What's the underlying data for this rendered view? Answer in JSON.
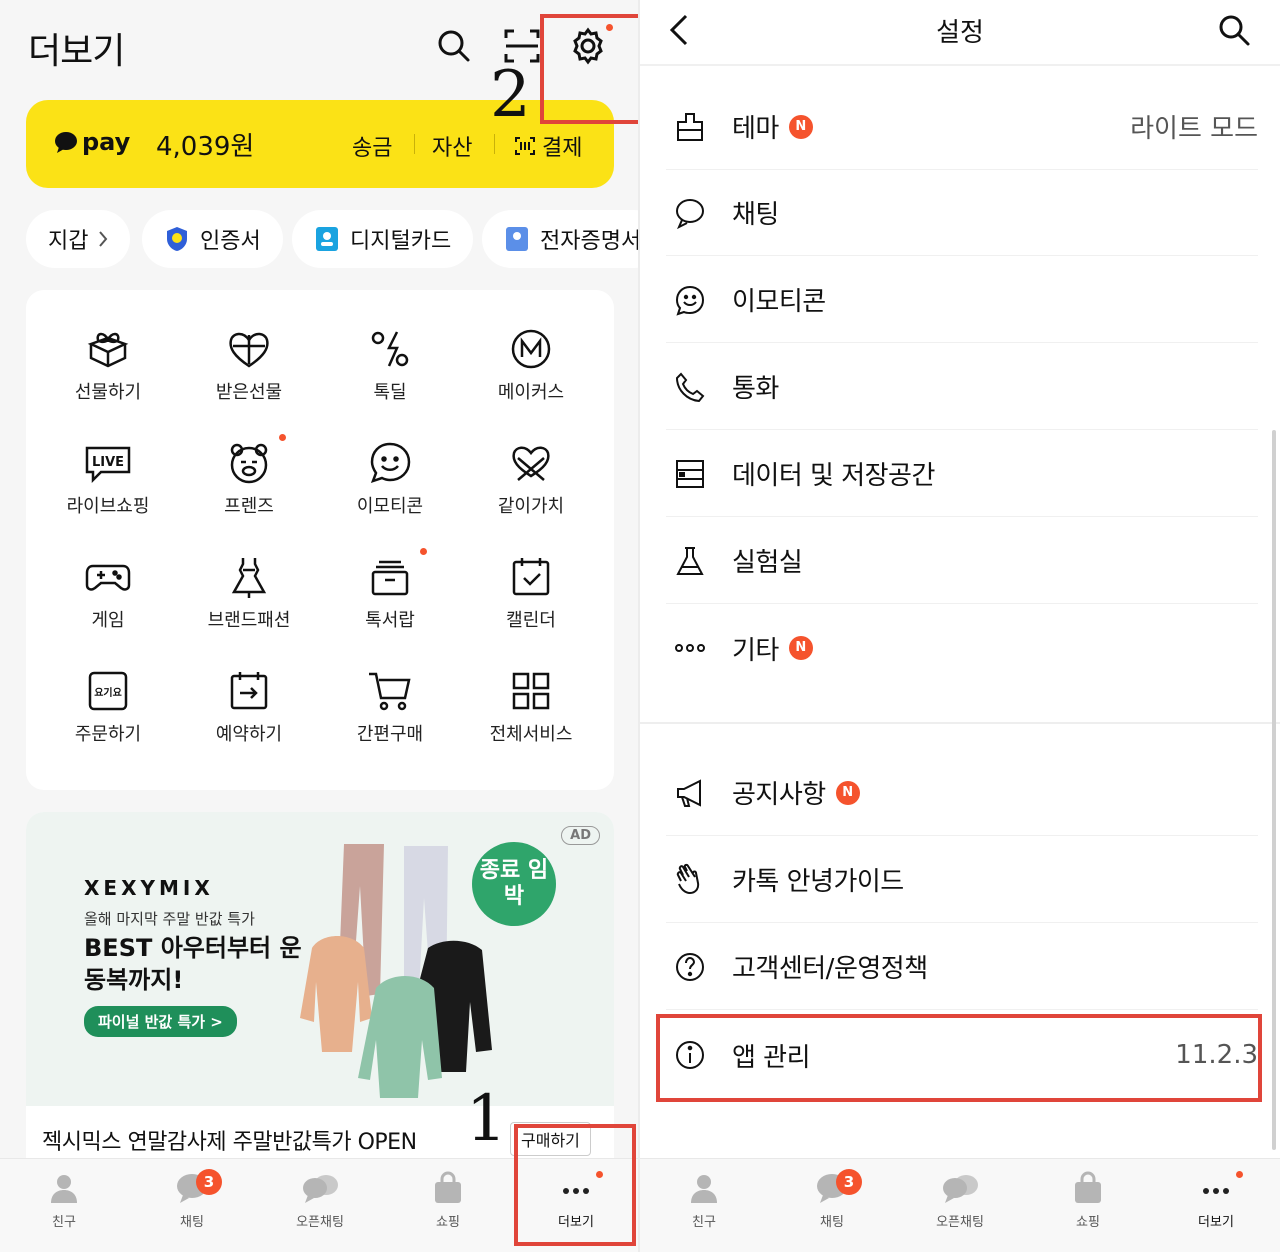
{
  "left": {
    "title": "더보기",
    "pay": {
      "logo": "pay",
      "balance": "4,039원",
      "actions": [
        "송금",
        "자산",
        "결제"
      ]
    },
    "chips": [
      "지갑",
      "인증서",
      "디지털카드",
      "전자증명서"
    ],
    "grid": [
      {
        "label": "선물하기",
        "icon": "gift-box-icon"
      },
      {
        "label": "받은선물",
        "icon": "heart-gift-icon"
      },
      {
        "label": "톡딜",
        "icon": "percent-bolt-icon"
      },
      {
        "label": "메이커스",
        "icon": "makers-m-icon"
      },
      {
        "label": "라이브쇼핑",
        "icon": "live-icon"
      },
      {
        "label": "프렌즈",
        "icon": "friends-bear-icon"
      },
      {
        "label": "이모티콘",
        "icon": "smile-bubble-icon"
      },
      {
        "label": "같이가치",
        "icon": "ribbon-heart-icon"
      },
      {
        "label": "게임",
        "icon": "gamepad-icon"
      },
      {
        "label": "브랜드패션",
        "icon": "dress-icon"
      },
      {
        "label": "톡서랍",
        "icon": "drawer-icon"
      },
      {
        "label": "캘린더",
        "icon": "calendar-check-icon"
      },
      {
        "label": "주문하기",
        "icon": "order-yogiyo-icon"
      },
      {
        "label": "예약하기",
        "icon": "reservation-icon"
      },
      {
        "label": "간편구매",
        "icon": "cart-icon"
      },
      {
        "label": "전체서비스",
        "icon": "grid-apps-icon"
      }
    ],
    "ad": {
      "tag": "AD",
      "brand": "XEXYMIX",
      "subtitle": "올해 마지막 주말 반값 특가",
      "headline": "BEST 아우터부터 운동복까지!",
      "cta": "파이널 반값 특가 >",
      "badge": "종료 임박",
      "text": "젝시믹스 연말감사제 주말반값특가 OPEN",
      "buy": "구매하기"
    },
    "annotations": {
      "one": "1",
      "two": "2"
    }
  },
  "tabs": [
    {
      "label": "친구",
      "icon": "person-icon"
    },
    {
      "label": "채팅",
      "icon": "chat-bubble-icon",
      "badge": "3"
    },
    {
      "label": "오픈채팅",
      "icon": "open-chat-icon"
    },
    {
      "label": "쇼핑",
      "icon": "shopping-bag-icon"
    },
    {
      "label": "더보기",
      "icon": "more-dots-icon"
    }
  ],
  "right": {
    "title": "설정",
    "rows": [
      {
        "label": "테마",
        "value": "라이트 모드",
        "new": "N",
        "icon": "theme-brush-icon"
      },
      {
        "label": "채팅",
        "icon": "chat-outline-icon"
      },
      {
        "label": "이모티콘",
        "icon": "emoticon-icon"
      },
      {
        "label": "통화",
        "icon": "phone-icon"
      },
      {
        "label": "데이터 및 저장공간",
        "icon": "storage-icon"
      },
      {
        "label": "실험실",
        "icon": "flask-icon"
      },
      {
        "label": "기타",
        "new": "N",
        "icon": "more-horizontal-icon"
      },
      {
        "label": "공지사항",
        "new": "N",
        "icon": "megaphone-icon"
      },
      {
        "label": "카톡 안녕가이드",
        "icon": "wave-hand-icon"
      },
      {
        "label": "고객센터/운영정책",
        "icon": "help-circle-icon"
      },
      {
        "label": "앱 관리",
        "value": "11.2.3",
        "icon": "info-circle-icon"
      }
    ]
  },
  "colors": {
    "accent": "#fbe216",
    "badge": "#f5532d",
    "highlight": "#e0453a"
  }
}
